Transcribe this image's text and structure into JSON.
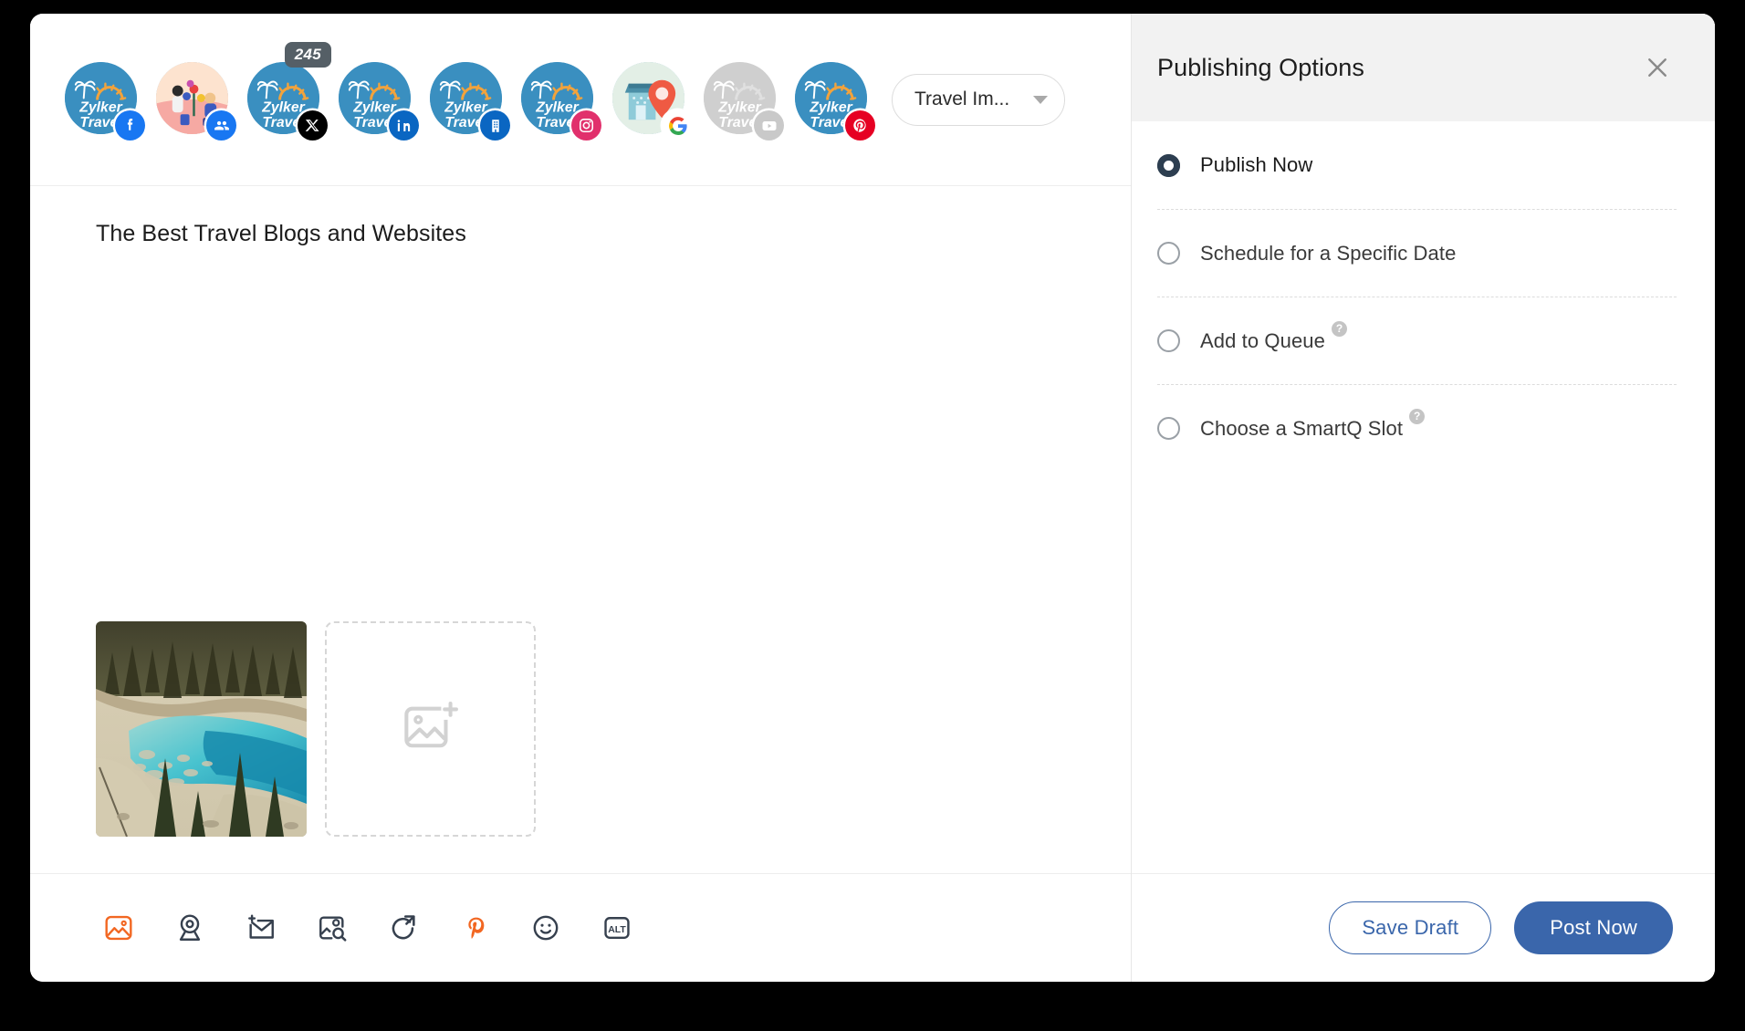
{
  "window": {
    "composer": {
      "accounts": [
        {
          "name": "Zylker Travel",
          "network": "facebook",
          "icon": "facebook-icon",
          "avatar": "zylker-logo",
          "disabled": false,
          "count": null
        },
        {
          "name": "Zylker Travel",
          "network": "facebook-group",
          "icon": "facebook-group-icon",
          "avatar": "group-photo",
          "disabled": false,
          "count": null
        },
        {
          "name": "Zylker Travel",
          "network": "x",
          "icon": "x-icon",
          "avatar": "zylker-logo",
          "disabled": false,
          "count": "245"
        },
        {
          "name": "Zylker Travel",
          "network": "linkedin",
          "icon": "linkedin-icon",
          "avatar": "zylker-logo",
          "disabled": false,
          "count": null
        },
        {
          "name": "Zylker Travel",
          "network": "linkedin-page",
          "icon": "linkedin-page-icon",
          "avatar": "zylker-logo",
          "disabled": false,
          "count": null
        },
        {
          "name": "Zylker Travel",
          "network": "instagram",
          "icon": "instagram-icon",
          "avatar": "zylker-logo",
          "disabled": false,
          "count": null
        },
        {
          "name": "Zylker Travel",
          "network": "google-business",
          "icon": "google-icon",
          "avatar": "storefront",
          "disabled": false,
          "count": null
        },
        {
          "name": "Zylker Travel",
          "network": "youtube",
          "icon": "youtube-icon",
          "avatar": "zylker-logo",
          "disabled": true,
          "count": null
        },
        {
          "name": "Zylker Travel",
          "network": "pinterest",
          "icon": "pinterest-icon",
          "avatar": "zylker-logo",
          "disabled": false,
          "count": null
        }
      ],
      "board_select": {
        "value": "Travel Im...",
        "icon": "chevron-down-icon"
      },
      "post_title": "The Best Travel Blogs and Websites",
      "media": {
        "thumbnail_alt": "Aerial view of a turquoise lake cove with pine trees and rocky shoreline",
        "add_icon": "add-image-icon"
      },
      "toolbar": [
        {
          "icon": "image-icon",
          "label": "Add Image",
          "active": true
        },
        {
          "icon": "location-icon",
          "label": "Add Location",
          "active": false
        },
        {
          "icon": "add-mail-icon",
          "label": "Add Draft",
          "active": false
        },
        {
          "icon": "image-search-icon",
          "label": "Image Search",
          "active": false
        },
        {
          "icon": "share-arrow-icon",
          "label": "Repost",
          "active": false
        },
        {
          "icon": "pinterest-icon",
          "label": "Pinterest",
          "active": true
        },
        {
          "icon": "emoji-icon",
          "label": "Emoji",
          "active": false
        },
        {
          "icon": "alt-text-icon",
          "label": "ALT",
          "active": false
        }
      ]
    },
    "publishing": {
      "title": "Publishing Options",
      "close_icon": "close-icon",
      "options": [
        {
          "label": "Publish Now",
          "selected": true,
          "help": false
        },
        {
          "label": "Schedule for a Specific Date",
          "selected": false,
          "help": false
        },
        {
          "label": "Add to Queue",
          "selected": false,
          "help": true
        },
        {
          "label": "Choose a SmartQ Slot",
          "selected": false,
          "help": true
        }
      ],
      "help_glyph": "?",
      "footer": {
        "save_draft_label": "Save Draft",
        "post_now_label": "Post Now"
      }
    }
  },
  "colors": {
    "primary": "#3a66ab",
    "accent": "#f26722",
    "radio_selected": "#2d3e50",
    "panel_header_bg": "#f2f2f2",
    "badge_bg": "#555f66"
  }
}
